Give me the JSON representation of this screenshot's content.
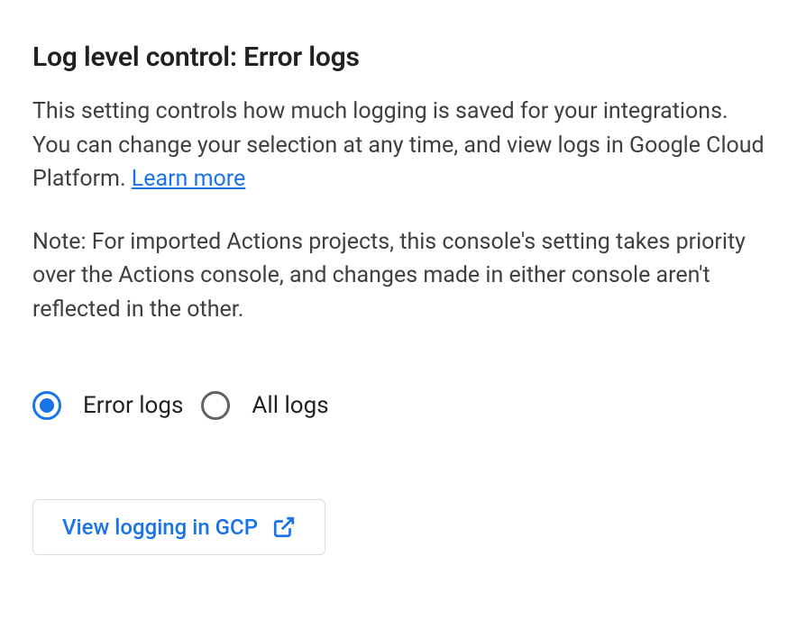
{
  "heading": "Log level control: Error logs",
  "description_text": "This setting controls how much logging is saved for your integrations. You can change your selection at any time, and view logs in Google Cloud Platform. ",
  "learn_more_label": "Learn more",
  "note_text": "Note: For imported Actions projects, this console's setting takes priority over the Actions console, and changes made in either console aren't reflected in the other.",
  "radio": {
    "error_logs_label": "Error logs",
    "all_logs_label": "All logs",
    "selected": "error_logs"
  },
  "view_button_label": "View logging in GCP",
  "colors": {
    "primary": "#1a73e8",
    "text": "#202124",
    "text_secondary": "#3c4043",
    "border": "#dadce0",
    "radio_unselected": "#5f6368"
  }
}
